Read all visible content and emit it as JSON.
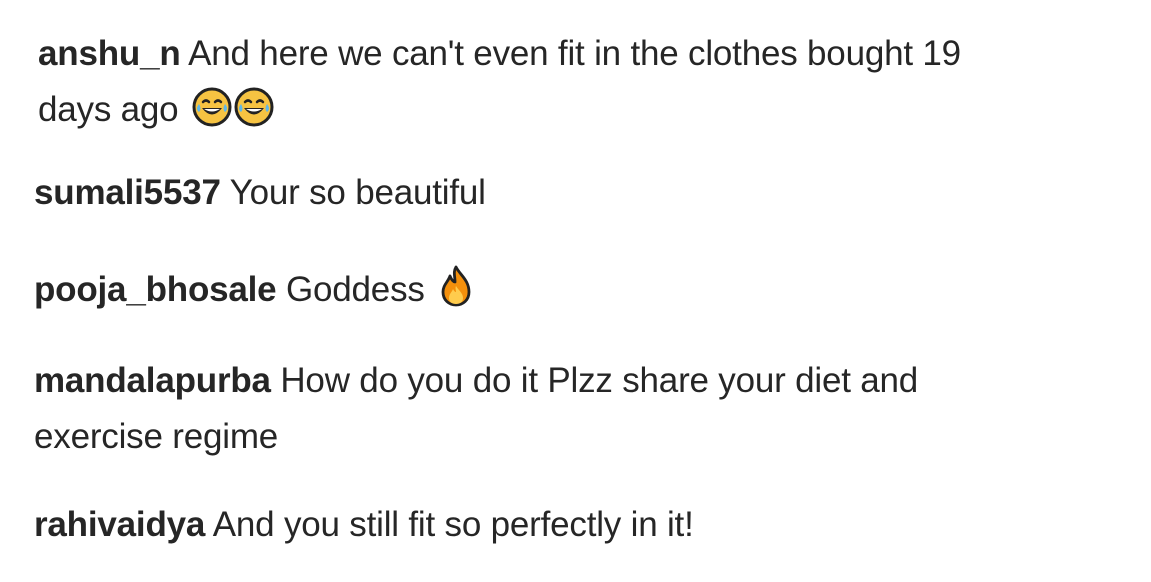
{
  "comments": [
    {
      "username": "anshu_n",
      "line1": "And here we can't even fit in the clothes bought 19",
      "line2": "days ago",
      "emojis": [
        "face-with-tears-of-joy-icon",
        "face-with-tears-of-joy-icon"
      ]
    },
    {
      "username": "sumali5537",
      "line1": "Your so beautiful"
    },
    {
      "username": "pooja_bhosale",
      "line1": "Goddess",
      "emojis": [
        "fire-icon"
      ]
    },
    {
      "username": "mandalapurba",
      "line1": "How do you do it Plzz share your diet and",
      "line2": "exercise regime"
    },
    {
      "username": "rahivaidya",
      "line1": "And you still fit so perfectly in it!"
    }
  ]
}
